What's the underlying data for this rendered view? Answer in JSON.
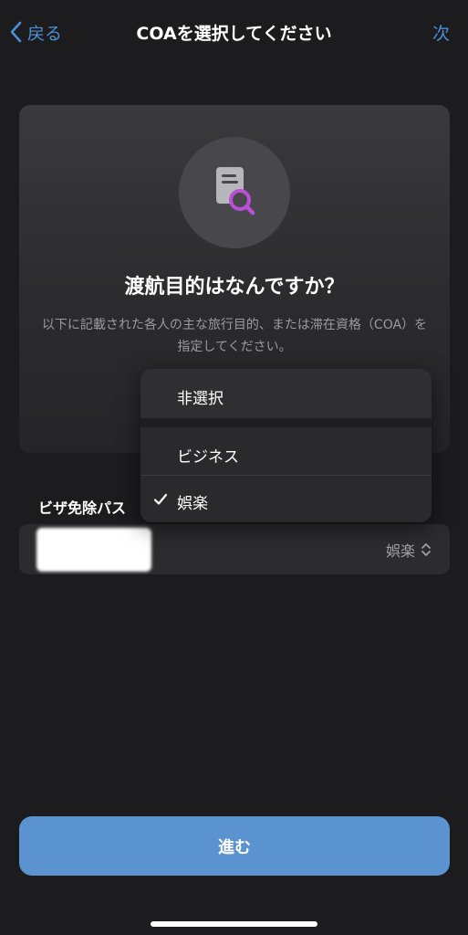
{
  "nav": {
    "back_label": "戻る",
    "title": "COAを選択してください",
    "next_label": "次"
  },
  "card": {
    "icon": "document-search-icon",
    "question": "渡航目的はなんですか？",
    "description": "以下に記載された各人の主な旅行目的、または滞在資格（COA）を指定してください。"
  },
  "section": {
    "label": "ビザ免除パス"
  },
  "row": {
    "selected_value": "娯楽"
  },
  "menu": {
    "options": [
      {
        "label": "非選択",
        "checked": false
      },
      {
        "label": "ビジネス",
        "checked": false
      },
      {
        "label": "娯楽",
        "checked": true
      }
    ]
  },
  "cta": {
    "label": "進む"
  },
  "colors": {
    "accent": "#4a90d6",
    "button": "#5b93d0",
    "icon_accent": "#b84fd6"
  }
}
